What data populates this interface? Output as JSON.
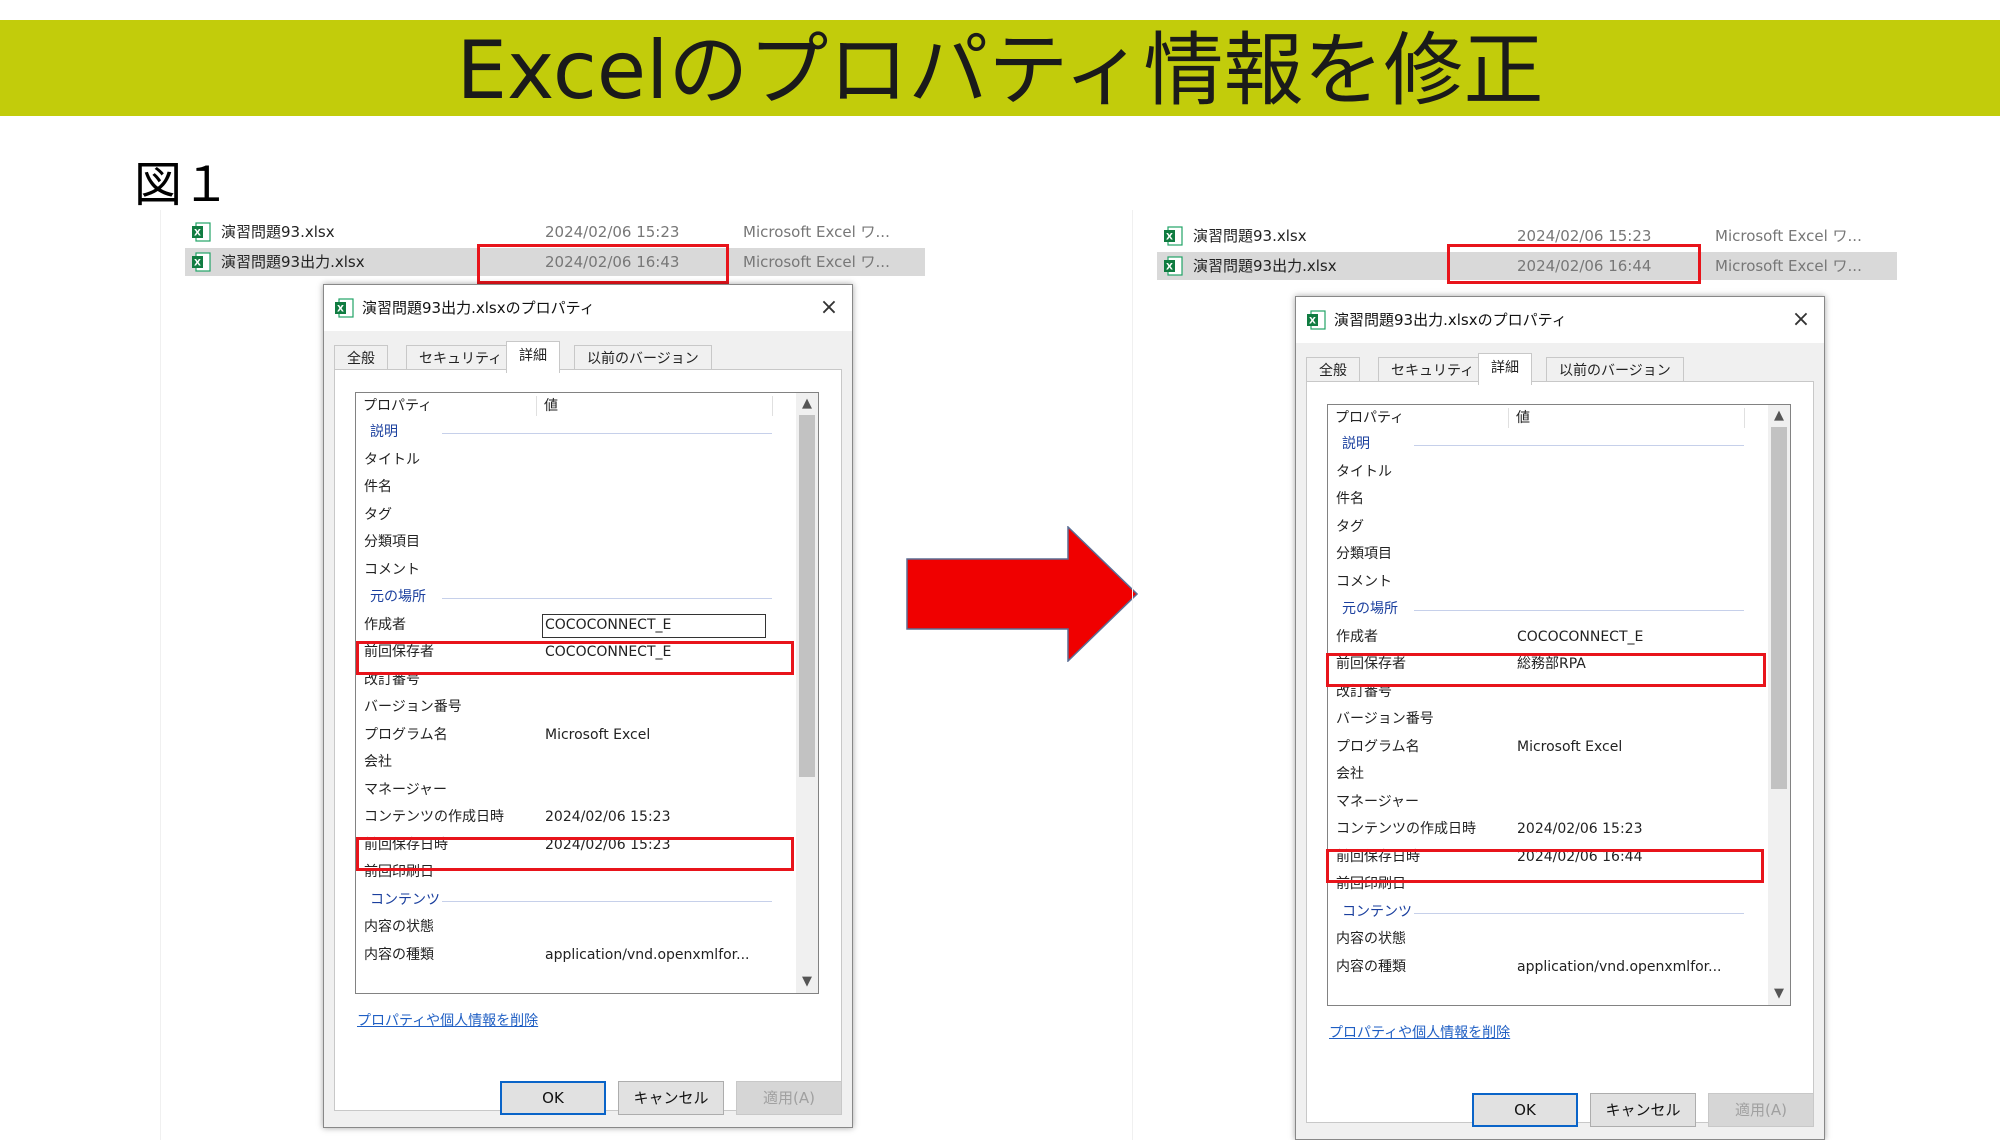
{
  "slide": {
    "title": "Excelのプロパティ情報を修正",
    "figure_label": "図１"
  },
  "colors": {
    "banner": "#c2cc0b",
    "highlight": "#e8141b",
    "arrow": "#f00000",
    "link": "#1f5fc4"
  },
  "left": {
    "files": [
      {
        "name": "演習問題93.xlsx",
        "date": "2024/02/06 15:23",
        "type": "Microsoft Excel ワ..."
      },
      {
        "name": "演習問題93出力.xlsx",
        "date": "2024/02/06 16:43",
        "type": "Microsoft Excel ワ..."
      }
    ],
    "dialog": {
      "title": "演習問題93出力.xlsxのプロパティ",
      "close": "×",
      "tabs": [
        "全般",
        "セキュリティ",
        "詳細",
        "以前のバージョン"
      ],
      "header": {
        "property": "プロパティ",
        "value": "値"
      },
      "rows": {
        "sec_desc": "説明",
        "title": "タイトル",
        "subject": "件名",
        "tags": "タグ",
        "category": "分類項目",
        "comments": "コメント",
        "sec_origin": "元の場所",
        "author_label": "作成者",
        "author_value": "COCOCONNECT_E",
        "lastsavedby_label": "前回保存者",
        "lastsavedby_value": "COCOCONNECT_E",
        "revision": "改訂番号",
        "version": "バージョン番号",
        "program_label": "プログラム名",
        "program_value": "Microsoft Excel",
        "company": "会社",
        "manager": "マネージャー",
        "created_label": "コンテンツの作成日時",
        "created_value": "2024/02/06 15:23",
        "saved_label": "前回保存日時",
        "saved_value": "2024/02/06 15:23",
        "printed": "前回印刷日",
        "sec_content": "コンテンツ",
        "status": "内容の状態",
        "contenttype_label": "内容の種類",
        "contenttype_value": "application/vnd.openxmlfor..."
      },
      "scroll_up": "▲",
      "scroll_down": "▼",
      "remove_link": "プロパティや個人情報を削除",
      "ok": "OK",
      "cancel": "キャンセル",
      "apply": "適用(A)"
    }
  },
  "right": {
    "files": [
      {
        "name": "演習問題93.xlsx",
        "date": "2024/02/06 15:23",
        "type": "Microsoft Excel ワ..."
      },
      {
        "name": "演習問題93出力.xlsx",
        "date": "2024/02/06 16:44",
        "type": "Microsoft Excel ワ..."
      }
    ],
    "dialog": {
      "title": "演習問題93出力.xlsxのプロパティ",
      "close": "×",
      "tabs": [
        "全般",
        "セキュリティ",
        "詳細",
        "以前のバージョン"
      ],
      "header": {
        "property": "プロパティ",
        "value": "値"
      },
      "rows": {
        "sec_desc": "説明",
        "title": "タイトル",
        "subject": "件名",
        "tags": "タグ",
        "category": "分類項目",
        "comments": "コメント",
        "sec_origin": "元の場所",
        "author_label": "作成者",
        "author_value": "COCOCONNECT_E",
        "lastsavedby_label": "前回保存者",
        "lastsavedby_value": "総務部RPA",
        "revision": "改訂番号",
        "version": "バージョン番号",
        "program_label": "プログラム名",
        "program_value": "Microsoft Excel",
        "company": "会社",
        "manager": "マネージャー",
        "created_label": "コンテンツの作成日時",
        "created_value": "2024/02/06 15:23",
        "saved_label": "前回保存日時",
        "saved_value": "2024/02/06 16:44",
        "printed": "前回印刷日",
        "sec_content": "コンテンツ",
        "status": "内容の状態",
        "contenttype_label": "内容の種類",
        "contenttype_value": "application/vnd.openxmlfor..."
      },
      "scroll_up": "▲",
      "scroll_down": "▼",
      "remove_link": "プロパティや個人情報を削除",
      "ok": "OK",
      "cancel": "キャンセル",
      "apply": "適用(A)"
    }
  }
}
